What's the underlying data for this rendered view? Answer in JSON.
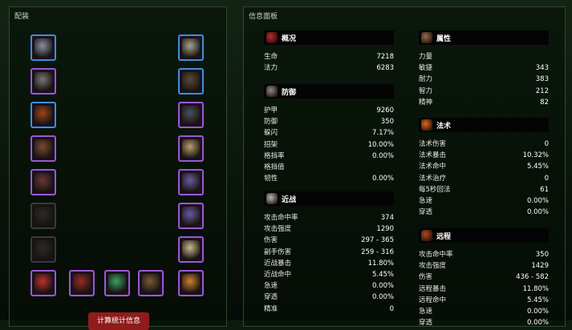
{
  "equip_panel": {
    "title": "配装",
    "calc_button": "计算统计信息"
  },
  "info_panel": {
    "title": "信息面板"
  },
  "slots": [
    {
      "name": "head-slot",
      "color": "blue",
      "icon": "helm-icon"
    },
    {
      "name": "neck-slot",
      "color": "purple",
      "icon": "necklace-icon"
    },
    {
      "name": "shoulder-slot",
      "color": "blue",
      "icon": "shoulder-icon"
    },
    {
      "name": "back-slot",
      "color": "purple",
      "icon": "cloak-icon"
    },
    {
      "name": "chest-slot",
      "color": "purple",
      "icon": "chest-icon"
    },
    {
      "name": "shirt-slot",
      "color": "gray",
      "icon": "shirt-icon"
    },
    {
      "name": "tabard-slot",
      "color": "gray",
      "icon": "tabard-icon"
    },
    {
      "name": "wrist-slot",
      "color": "purple",
      "icon": "bracer-icon"
    },
    {
      "name": "hands-slot",
      "color": "blue",
      "icon": "gauntlet-icon"
    },
    {
      "name": "waist-slot",
      "color": "purple",
      "icon": "belt-icon"
    },
    {
      "name": "legs-slot",
      "color": "blue",
      "icon": "legs-icon"
    },
    {
      "name": "feet-slot",
      "color": "purple",
      "icon": "boots-icon"
    },
    {
      "name": "finger1-slot",
      "color": "purple",
      "icon": "ring-icon"
    },
    {
      "name": "finger2-slot",
      "color": "purple",
      "icon": "ring-icon"
    },
    {
      "name": "trinket1-slot",
      "color": "purple",
      "icon": "claw-icon"
    },
    {
      "name": "trinket2-slot",
      "color": "purple",
      "icon": "gem-icon"
    },
    {
      "name": "mainhand-slot",
      "color": "purple",
      "icon": "dagger-icon"
    },
    {
      "name": "offhand-slot",
      "color": "purple",
      "icon": "blade-icon"
    },
    {
      "name": "ranged-slot",
      "color": "purple",
      "icon": "wand-icon"
    }
  ],
  "sections": {
    "overview": {
      "title": "概况",
      "icon": "heart-icon",
      "color": "#c0282d",
      "rows": [
        {
          "k": "生命",
          "v": "7218"
        },
        {
          "k": "法力",
          "v": "6283"
        }
      ]
    },
    "defense": {
      "title": "防御",
      "icon": "shield-icon",
      "color": "#8a8a8a",
      "rows": [
        {
          "k": "护甲",
          "v": "9260"
        },
        {
          "k": "防御",
          "v": "350"
        },
        {
          "k": "躲闪",
          "v": "7.17%"
        },
        {
          "k": "招架",
          "v": "10.00%"
        },
        {
          "k": "格挡率",
          "v": "0.00%"
        },
        {
          "k": "格挡值",
          "v": ""
        },
        {
          "k": "韧性",
          "v": "0.00%"
        }
      ]
    },
    "melee": {
      "title": "近战",
      "icon": "swords-icon",
      "color": "#b5b5b5",
      "rows": [
        {
          "k": "攻击命中率",
          "v": "374"
        },
        {
          "k": "攻击强度",
          "v": "1290"
        },
        {
          "k": "伤害",
          "v": "297 - 365"
        },
        {
          "k": "副手伤害",
          "v": "259 - 316"
        },
        {
          "k": "近战暴击",
          "v": "11.80%"
        },
        {
          "k": "近战命中",
          "v": "5.45%"
        },
        {
          "k": "急速",
          "v": "0.00%"
        },
        {
          "k": "穿透",
          "v": "0.00%"
        },
        {
          "k": "精准",
          "v": "0"
        }
      ]
    },
    "attributes": {
      "title": "属性",
      "icon": "fist-icon",
      "color": "#9a6a4a",
      "rows": [
        {
          "k": "力量",
          "v": ""
        },
        {
          "k": "敏捷",
          "v": "343"
        },
        {
          "k": "耐力",
          "v": "383"
        },
        {
          "k": "智力",
          "v": "212"
        },
        {
          "k": "精神",
          "v": "82"
        }
      ]
    },
    "spell": {
      "title": "法术",
      "icon": "fire-icon",
      "color": "#e8661a",
      "rows": [
        {
          "k": "法术伤害",
          "v": "0"
        },
        {
          "k": "法术暴击",
          "v": "10.32%"
        },
        {
          "k": "法术命中",
          "v": "5.45%"
        },
        {
          "k": "法术治疗",
          "v": "0"
        },
        {
          "k": "每5秒回法",
          "v": "61"
        },
        {
          "k": "急速",
          "v": "0.00%"
        },
        {
          "k": "穿透",
          "v": "0.00%"
        }
      ]
    },
    "ranged": {
      "title": "远程",
      "icon": "bow-icon",
      "color": "#b04a20",
      "rows": [
        {
          "k": "攻击命中率",
          "v": "350"
        },
        {
          "k": "攻击强度",
          "v": "1429"
        },
        {
          "k": "伤害",
          "v": "436 - 582"
        },
        {
          "k": "远程暴击",
          "v": "11.80%"
        },
        {
          "k": "远程命中",
          "v": "5.45%"
        },
        {
          "k": "急速",
          "v": "0.00%"
        },
        {
          "k": "穿透",
          "v": "0.00%"
        }
      ]
    }
  }
}
